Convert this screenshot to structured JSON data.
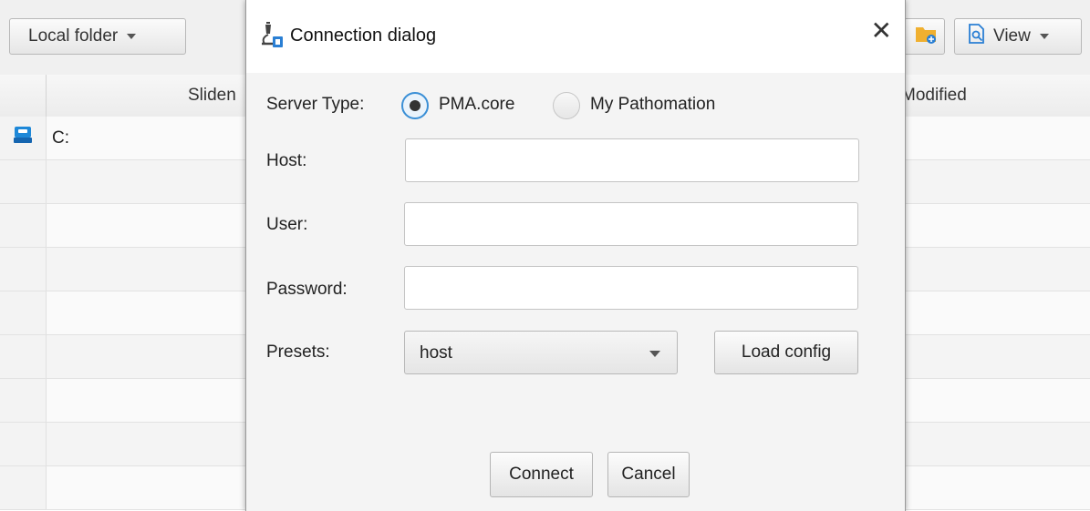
{
  "app": {
    "toolbar": {
      "folder_dropdown_label": "Local folder",
      "view_button_label": "View"
    },
    "table": {
      "columns": [
        "Sliden",
        "Modified"
      ],
      "rows": [
        {
          "icon": "drive-icon",
          "name": "C:"
        }
      ]
    }
  },
  "dialog": {
    "title": "Connection dialog",
    "server_type_label": "Server Type:",
    "server_types": [
      "PMA.core",
      "My Pathomation"
    ],
    "selected_server_type": "PMA.core",
    "host_label": "Host:",
    "host_value": "",
    "user_label": "User:",
    "user_value": "",
    "password_label": "Password:",
    "password_value": "",
    "presets_label": "Presets:",
    "preset_selected": "host",
    "load_config_label": "Load config",
    "connect_label": "Connect",
    "cancel_label": "Cancel"
  },
  "colors": {
    "accent": "#3a8fd6",
    "folder_icon": "#f0b030",
    "drive_icon": "#1e88d8"
  }
}
